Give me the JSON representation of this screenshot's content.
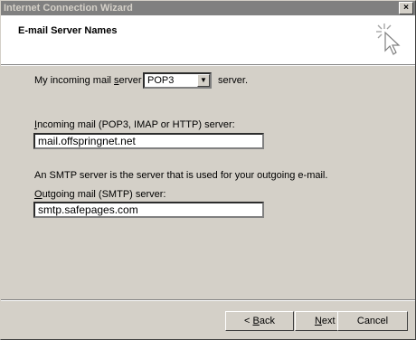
{
  "window": {
    "title": "Internet Connection Wizard",
    "close_symbol": "×"
  },
  "header": {
    "title": "E-mail Server Names"
  },
  "incoming_type": {
    "prefix": "My incoming mail ",
    "prefix_underline": "s",
    "prefix_rest": "erver is a",
    "selected": "POP3",
    "suffix": "server."
  },
  "incoming": {
    "label_underline": "I",
    "label_rest": "ncoming mail (POP3, IMAP or HTTP) server:",
    "value": "mail.offspringnet.net"
  },
  "smtp_note": "An SMTP server is the server that is used for your outgoing e-mail.",
  "outgoing": {
    "label_underline": "O",
    "label_rest": "utgoing mail (SMTP) server:",
    "value": "smtp.safepages.com"
  },
  "buttons": {
    "back_prefix": "< ",
    "back_underline": "B",
    "back_rest": "ack",
    "next_underline": "N",
    "next_rest": "ext >",
    "cancel": "Cancel"
  }
}
